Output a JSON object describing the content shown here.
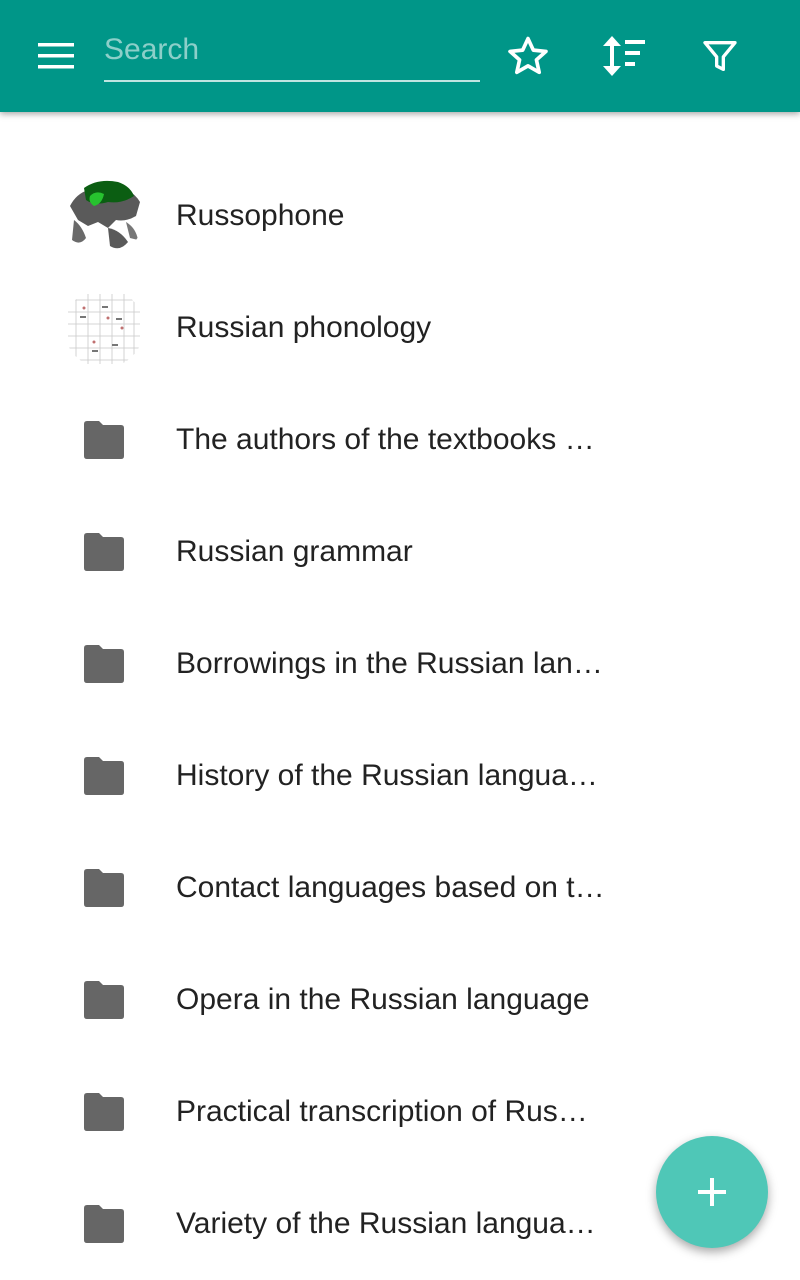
{
  "colors": {
    "toolbar": "#009688",
    "fab": "#4fc7b7",
    "folder": "#666666",
    "text": "#222222"
  },
  "toolbar": {
    "menu_icon": "hamburger-menu-icon",
    "search_placeholder": "Search",
    "search_value": "",
    "actions": [
      "star-icon",
      "sort-icon",
      "filter-icon"
    ]
  },
  "items": [
    {
      "label": "Russophone",
      "kind": "image",
      "icon": "world-map-thumbnail"
    },
    {
      "label": "Russian phonology",
      "kind": "image",
      "icon": "vowel-chart-thumbnail"
    },
    {
      "label": "The authors of the textbooks …",
      "kind": "folder",
      "icon": "folder-icon"
    },
    {
      "label": "Russian grammar",
      "kind": "folder",
      "icon": "folder-icon"
    },
    {
      "label": "Borrowings in the Russian lan…",
      "kind": "folder",
      "icon": "folder-icon"
    },
    {
      "label": "History of the Russian langua…",
      "kind": "folder",
      "icon": "folder-icon"
    },
    {
      "label": "Contact languages based on t…",
      "kind": "folder",
      "icon": "folder-icon"
    },
    {
      "label": "Opera in the Russian language",
      "kind": "folder",
      "icon": "folder-icon"
    },
    {
      "label": "Practical transcription of Rus…",
      "kind": "folder",
      "icon": "folder-icon"
    },
    {
      "label": "Variety of the Russian langua…",
      "kind": "folder",
      "icon": "folder-icon"
    }
  ],
  "fab": {
    "icon": "plus-icon"
  }
}
